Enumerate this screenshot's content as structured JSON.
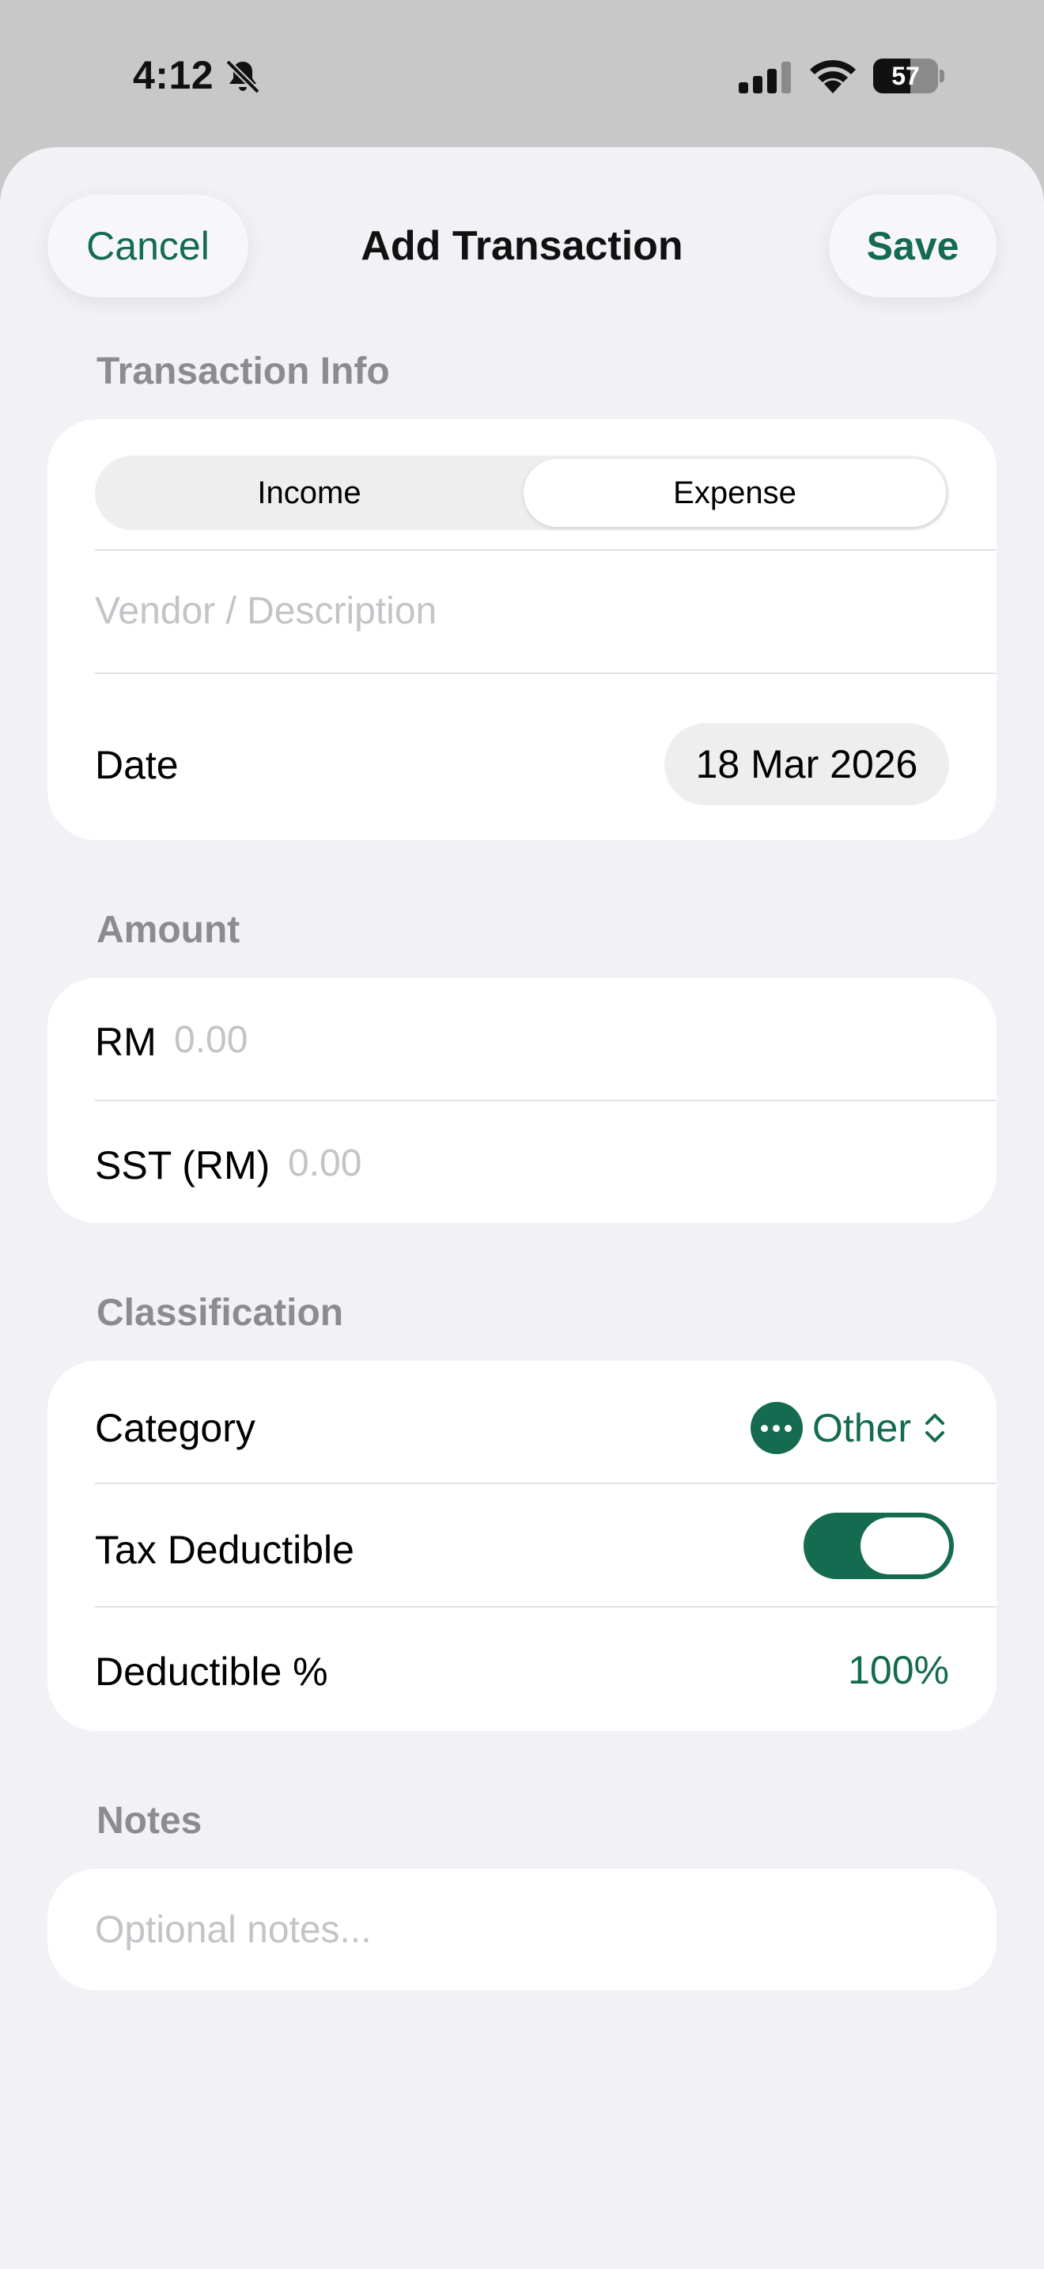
{
  "status_bar": {
    "time": "4:12",
    "battery": "57",
    "battery_level": 0.57
  },
  "nav": {
    "cancel_label": "Cancel",
    "title": "Add Transaction",
    "save_label": "Save"
  },
  "transaction_info": {
    "header": "Transaction Info",
    "segments": [
      "Income",
      "Expense"
    ],
    "selected_segment": "Expense",
    "vendor_placeholder": "Vendor / Description",
    "vendor_value": "",
    "date_label": "Date",
    "date_value": "18 Mar 2026"
  },
  "amount": {
    "header": "Amount",
    "rm_label": "RM",
    "rm_placeholder": "0.00",
    "sst_label": "SST (RM)",
    "sst_placeholder": "0.00"
  },
  "classification": {
    "header": "Classification",
    "category_label": "Category",
    "category_value": "Other",
    "tax_deductible_label": "Tax Deductible",
    "tax_deductible_on": true,
    "deductible_percent_label": "Deductible %",
    "deductible_percent_value": "100%"
  },
  "notes": {
    "header": "Notes",
    "placeholder": "Optional notes..."
  },
  "colors": {
    "accent": "#146b4f",
    "background": "#f1f1f6",
    "card": "#ffffff",
    "status_bar": "#c8c8c8"
  }
}
